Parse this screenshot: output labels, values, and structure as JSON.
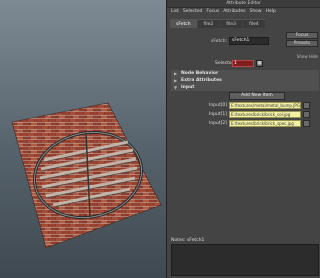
{
  "window": {
    "title": "Attribute Editor"
  },
  "menu": [
    "List",
    "Selected",
    "Focus",
    "Attributes",
    "Show",
    "Help"
  ],
  "tabs": [
    {
      "label": "sFetch"
    },
    {
      "label": "file2"
    },
    {
      "label": "file3"
    },
    {
      "label": "file4"
    }
  ],
  "node": {
    "type_label": "sFetch:",
    "name": "sFetch1",
    "buttons": {
      "focus": "Focus",
      "presets": "Presets",
      "show": "Show",
      "hide": "Hide"
    }
  },
  "selector": {
    "label": "Selector",
    "value": "1"
  },
  "sections": {
    "node_behavior": "Node Behavior",
    "extra_attributes": "Extra Attributes",
    "input": "Input"
  },
  "add_new_item_label": "Add New Item",
  "inputs": [
    {
      "label": "Input[0]",
      "value": "E:/textures/metal/metal_bump.JPG"
    },
    {
      "label": "Input[1]",
      "value": "E:/textures/brick/brick_col.jpg"
    },
    {
      "label": "Input[2]",
      "value": "E:/textures/brick/brick_spec.jpg"
    }
  ],
  "notes_label": "Notes: sFetch1",
  "colors": {
    "panel_bg": "#444444",
    "selector_field": "#7d2020",
    "input_field": "#f3f0a6"
  },
  "icons": [
    "expand-triangle-icon",
    "collapse-triangle-icon",
    "folder-icon",
    "tab-arrow-icon"
  ]
}
